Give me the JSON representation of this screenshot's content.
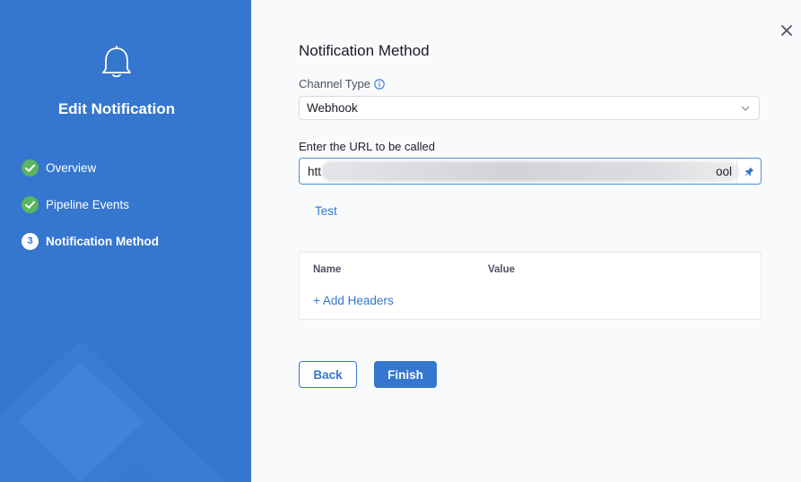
{
  "colors": {
    "sidebar_bg": "#3576ce",
    "accent": "#3576ce",
    "step_done": "#5ab55e"
  },
  "sidebar": {
    "icon": "bell-icon",
    "title": "Edit Notification",
    "steps": [
      {
        "label": "Overview",
        "state": "complete",
        "icon": "check-circle-icon"
      },
      {
        "label": "Pipeline Events",
        "state": "complete",
        "icon": "check-circle-icon"
      },
      {
        "label": "Notification Method",
        "state": "current",
        "number": "3"
      }
    ]
  },
  "main": {
    "title": "Notification Method",
    "channel_type": {
      "label": "Channel Type",
      "value": "Webhook"
    },
    "url": {
      "label": "Enter the URL to be called",
      "value_start": "htt",
      "value_end": "ool"
    },
    "test_label": "Test",
    "headers": {
      "name_col": "Name",
      "value_col": "Value",
      "add_label": "+ Add Headers"
    },
    "back_label": "Back",
    "finish_label": "Finish"
  }
}
